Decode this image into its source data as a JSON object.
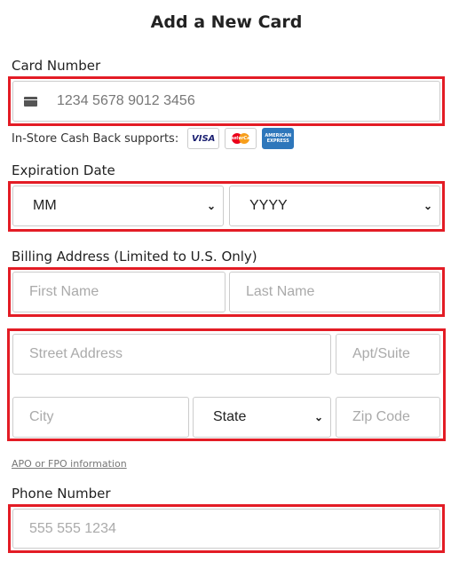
{
  "title": "Add a New Card",
  "card_number": {
    "label": "Card Number",
    "placeholder": "1234 5678 9012 3456",
    "icon": "credit-card-icon"
  },
  "cashback": {
    "text": "In-Store Cash Back supports:",
    "brands": [
      "VISA",
      "MasterCard",
      "AMERICAN EXPRESS"
    ]
  },
  "expiration": {
    "label": "Expiration Date",
    "month": "MM",
    "year": "YYYY"
  },
  "billing": {
    "label": "Billing Address (Limited to U.S. Only)",
    "first_name": "First Name",
    "last_name": "Last Name",
    "street": "Street Address",
    "apt": "Apt/Suite",
    "city": "City",
    "state": "State",
    "zip": "Zip Code"
  },
  "apo_link": "APO or FPO information",
  "phone": {
    "label": "Phone Number",
    "placeholder": "555 555 1234"
  },
  "colors": {
    "highlight": "#e31c25",
    "amex": "#2e77bb",
    "visa": "#1a1f71"
  }
}
